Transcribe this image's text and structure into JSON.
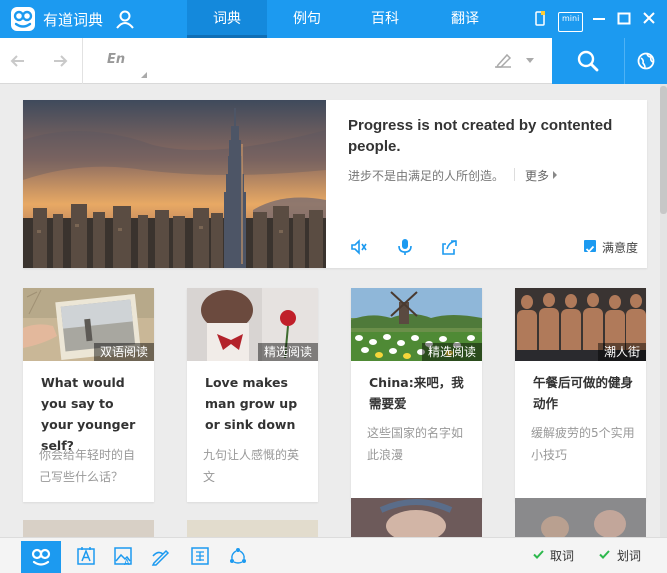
{
  "app": {
    "title": "有道词典"
  },
  "nav": {
    "tabs": [
      {
        "label": "词典",
        "active": true
      },
      {
        "label": "例句",
        "active": false
      },
      {
        "label": "百科",
        "active": false
      },
      {
        "label": "翻译",
        "active": false
      }
    ]
  },
  "window": {
    "mini_label": "mini"
  },
  "search": {
    "lang": "En",
    "value": "",
    "placeholder": ""
  },
  "daily": {
    "sentence_en": "Progress is not created by contented people.",
    "sentence_cn": "进步不是由满足的人所创造。",
    "more_label": "更多",
    "satisfaction_label": "满意度",
    "satisfaction_checked": true
  },
  "cards": [
    {
      "tag": "双语阅读",
      "title": "What would you say to your younger self?",
      "desc": "你会给年轻时的自己写些什么话？"
    },
    {
      "tag": "精选阅读",
      "title": "Love makes man grow up or sink down",
      "desc": "九句让人感慨的英文"
    },
    {
      "tag": "精选阅读",
      "title": "China:来吧，我需要爱",
      "desc": "这些国家的名字如此浪漫"
    },
    {
      "tag": "潮人街",
      "title": "午餐后可做的健身动作",
      "desc": "缓解疲劳的5个实用小技巧"
    }
  ],
  "bottom": {
    "word_pick_label": "取词",
    "word_select_label": "划词"
  },
  "colors": {
    "brand": "#1c9af0",
    "check": "#2db84d"
  },
  "icons": {
    "logo": "youdao-logo",
    "user": "user-icon",
    "back": "back-arrow-icon",
    "forward": "forward-arrow-icon",
    "pen": "handwriting-icon",
    "search": "search-icon",
    "globe": "globe-icon",
    "speaker": "speaker-icon",
    "mic": "microphone-icon",
    "share": "share-icon"
  }
}
